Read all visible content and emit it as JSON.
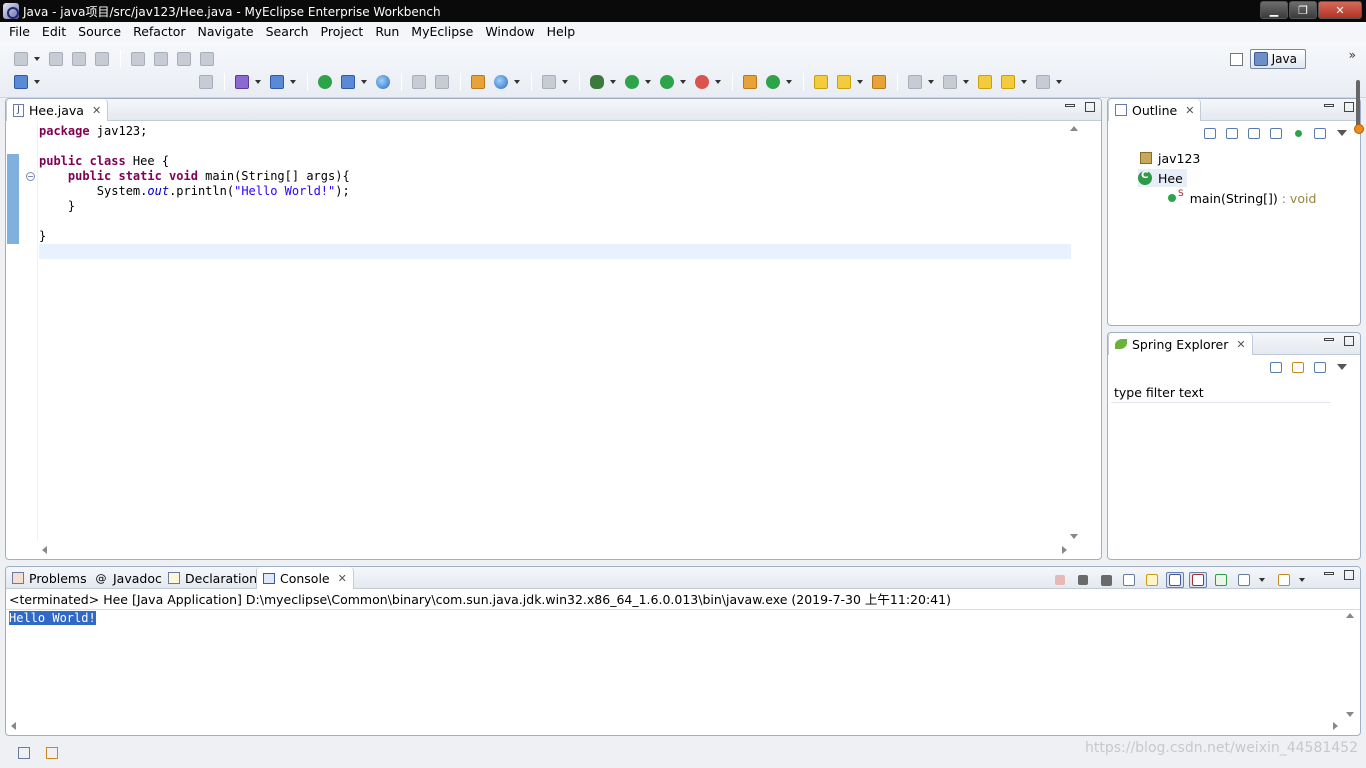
{
  "window": {
    "title": "Java - java项目/src/jav123/Hee.java - MyEclipse Enterprise Workbench",
    "minimize_label": "▁",
    "maximize_label": "❐",
    "close_label": "✕"
  },
  "menu": {
    "items": [
      "File",
      "Edit",
      "Source",
      "Refactor",
      "Navigate",
      "Search",
      "Project",
      "Run",
      "MyEclipse",
      "Window",
      "Help"
    ]
  },
  "perspective": {
    "label": "Java",
    "chevron": "»"
  },
  "editor": {
    "tab_label": "Hee.java",
    "tab_close": "✕",
    "code": {
      "line1": "package jav123;",
      "line3_kw": "public class",
      "line3_rest": " Hee {",
      "line4_kw": "public static void",
      "line4_rest": " main(String[] args){",
      "line5_pre": "System.",
      "line5_it": "out",
      "line5_mid": ".println(",
      "line5_str": "\"Hello World!\"",
      "line5_end": ");",
      "line6": "    }",
      "line8": "}"
    }
  },
  "outline": {
    "tab_label": "Outline",
    "tab_close": "✕",
    "items": {
      "package": "jav123",
      "class": "Hee",
      "method_sup": "S",
      "method": "main(String[])",
      "method_return": " : void"
    }
  },
  "spring": {
    "tab_label": "Spring Explorer",
    "tab_close": "✕",
    "filter_placeholder": "type filter text"
  },
  "bottom": {
    "tabs": {
      "problems": "Problems",
      "javadoc": "Javadoc",
      "javadoc_icon": "@",
      "declaration": "Declaration",
      "console": "Console",
      "console_close": "✕"
    },
    "console_header": "<terminated> Hee [Java Application] D:\\myeclipse\\Common\\binary\\com.sun.java.jdk.win32.x86_64_1.6.0.013\\bin\\javaw.exe (2019-7-30 上午11:20:41)",
    "output": "Hello World!"
  },
  "status": {
    "watermark": "https://blog.csdn.net/weixin_44581452"
  },
  "colors": {
    "keyword": "#7f0055",
    "string": "#2a00ff",
    "field": "#0000c0",
    "selection": "#3169c6",
    "current_line": "#e8f2fe"
  }
}
